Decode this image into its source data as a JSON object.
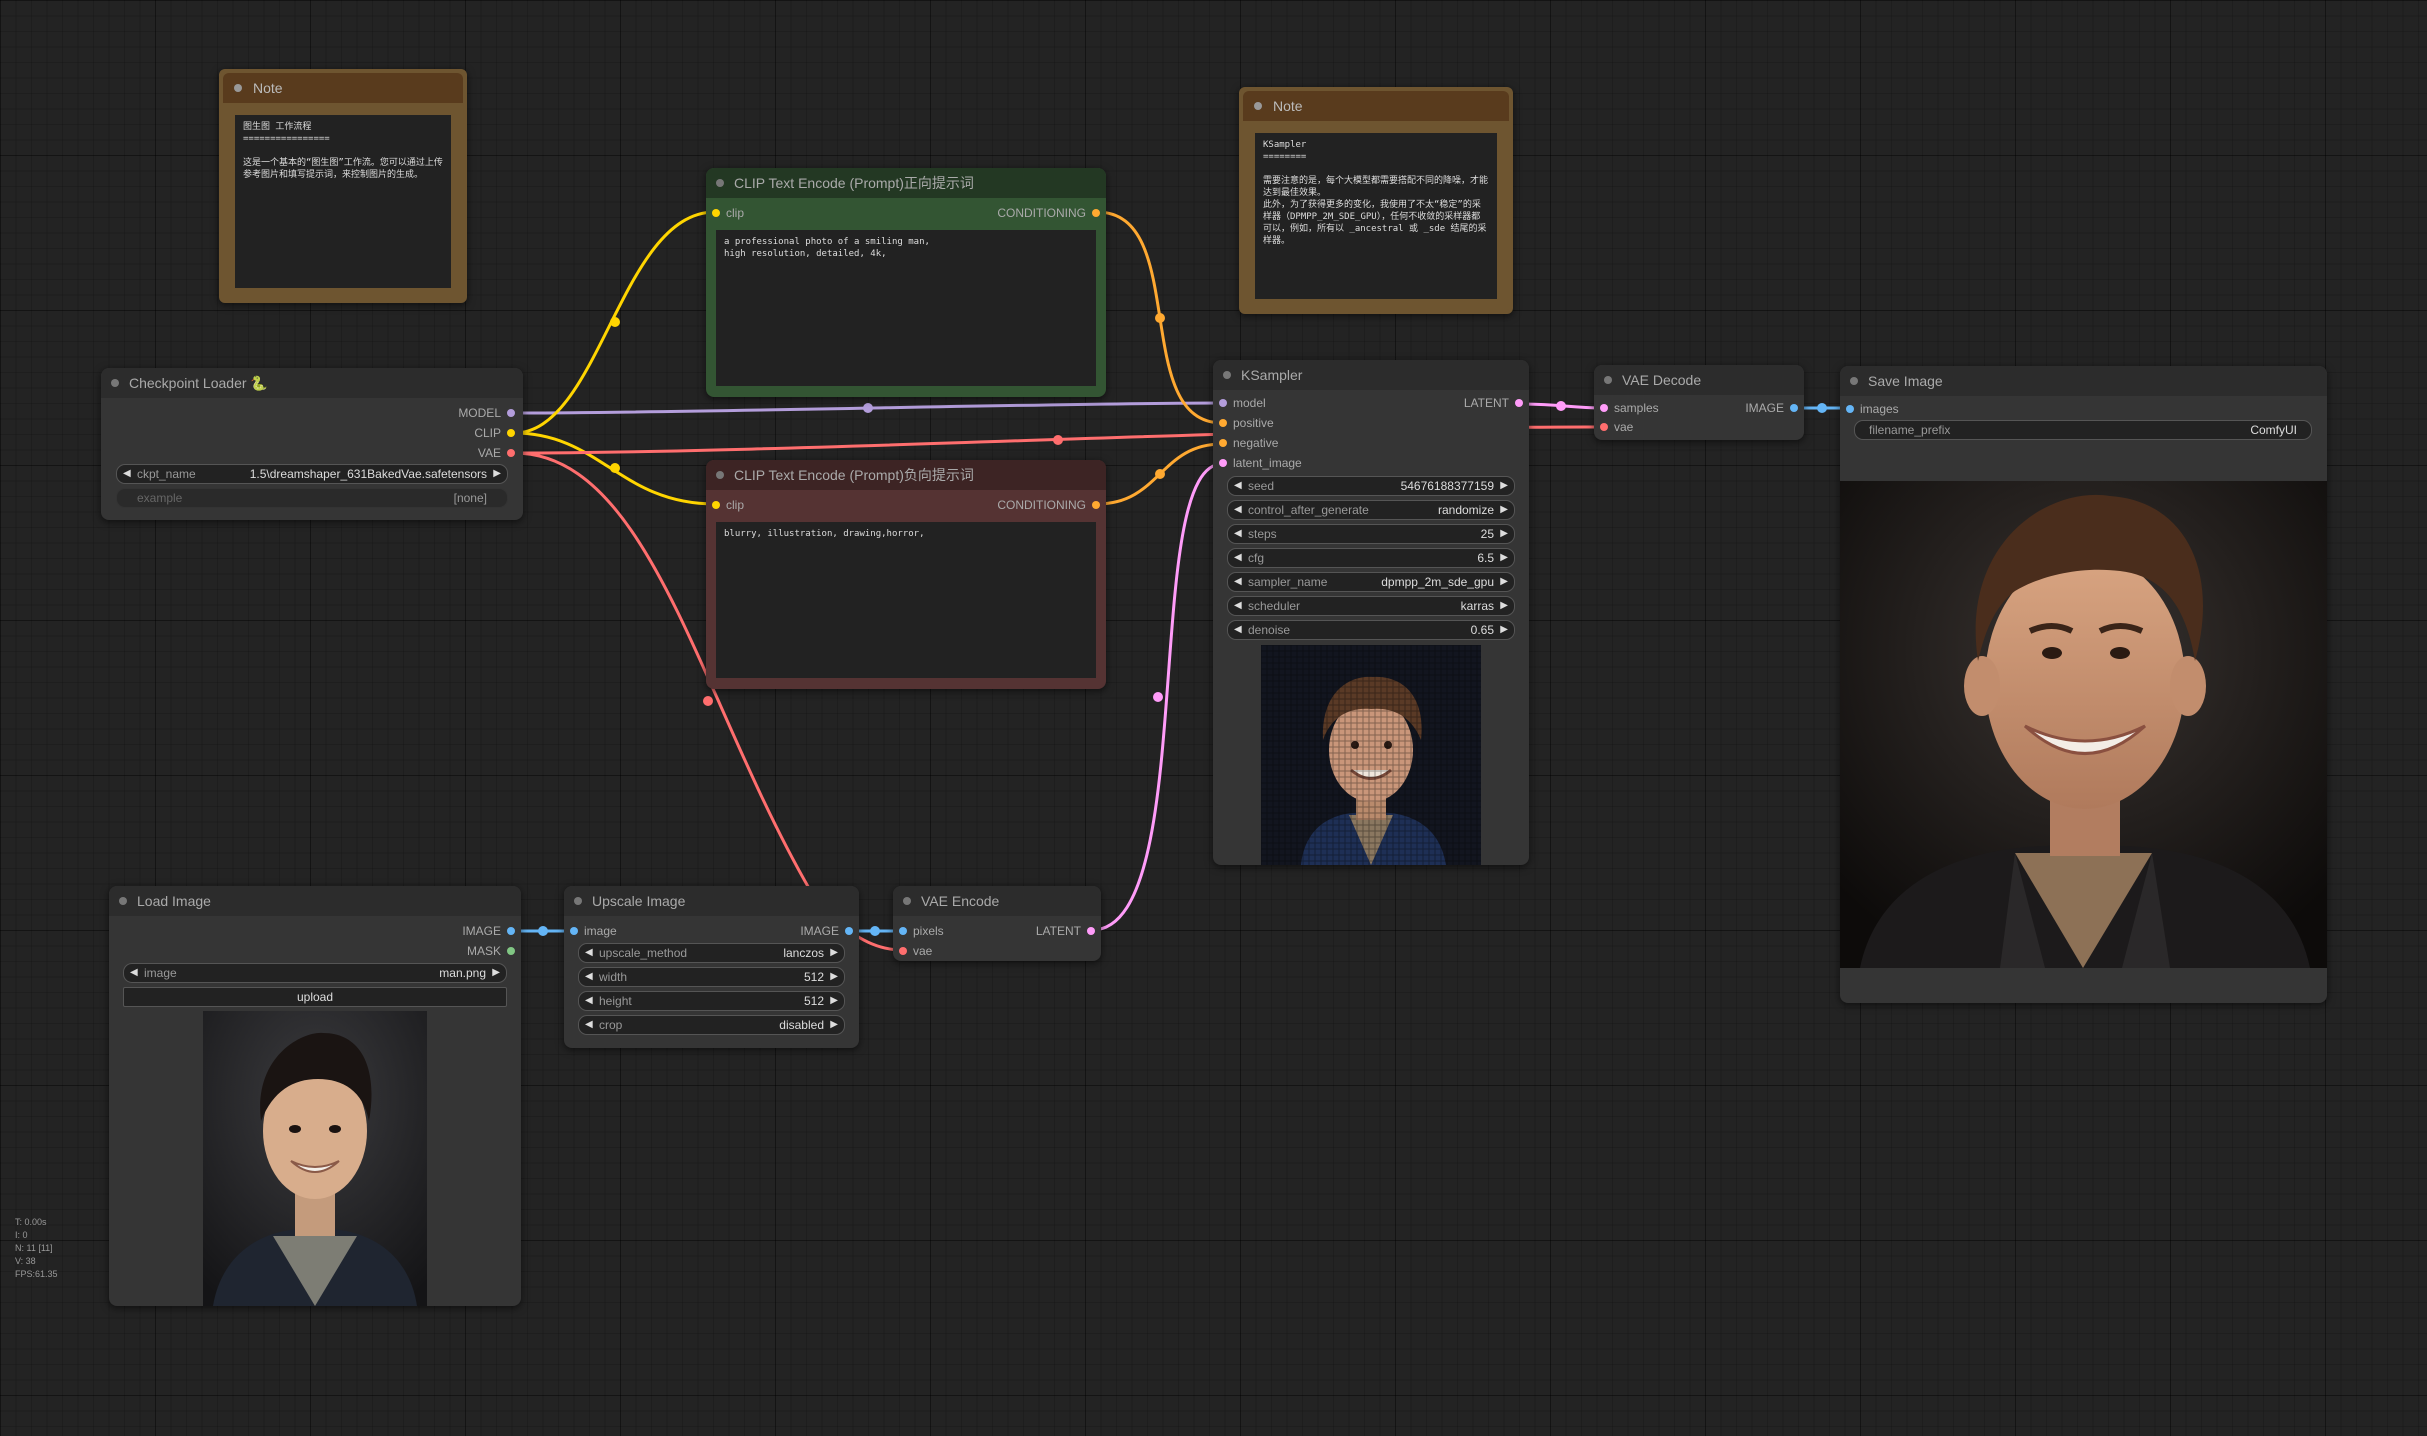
{
  "notes": [
    {
      "title": "Note",
      "text": "图生图 工作流程\n================\n\n这是一个基本的“图生图”工作流。您可以通过上传参考图片和填写提示词，来控制图片的生成。"
    },
    {
      "title": "Note",
      "text": "KSampler\n========\n\n需要注意的是，每个大模型都需要搭配不同的降噪，才能达到最佳效果。\n此外，为了获得更多的变化，我使用了不太“稳定”的采样器（DPMPP_2M_SDE_GPU），任何不收敛的采样器都可以，例如，所有以 _ancestral 或 _sde 结尾的采样器。"
    }
  ],
  "checkpoint": {
    "title": "Checkpoint Loader 🐍",
    "outputs": [
      "MODEL",
      "CLIP",
      "VAE"
    ],
    "ckpt_name_label": "ckpt_name",
    "ckpt_name": "1.5\\dreamshaper_631BakedVae.safetensors",
    "example_label": "example",
    "example_value": "[none]"
  },
  "clip_pos": {
    "title": "CLIP Text Encode (Prompt)正向提示词",
    "input": "clip",
    "output": "CONDITIONING",
    "text": "a professional photo of a smiling man,\nhigh resolution, detailed, 4k,"
  },
  "clip_neg": {
    "title": "CLIP Text Encode (Prompt)负向提示词",
    "input": "clip",
    "output": "CONDITIONING",
    "text": "blurry, illustration, drawing,horror,"
  },
  "ksampler": {
    "title": "KSampler",
    "inputs": [
      "model",
      "positive",
      "negative",
      "latent_image"
    ],
    "output": "LATENT",
    "widgets": [
      {
        "name": "seed",
        "value": "54676188377159"
      },
      {
        "name": "control_after_generate",
        "value": "randomize"
      },
      {
        "name": "steps",
        "value": "25"
      },
      {
        "name": "cfg",
        "value": "6.5"
      },
      {
        "name": "sampler_name",
        "value": "dpmpp_2m_sde_gpu"
      },
      {
        "name": "scheduler",
        "value": "karras"
      },
      {
        "name": "denoise",
        "value": "0.65"
      }
    ]
  },
  "vae_decode": {
    "title": "VAE Decode",
    "inputs": [
      "samples",
      "vae"
    ],
    "output": "IMAGE"
  },
  "save_image": {
    "title": "Save Image",
    "input": "images",
    "prefix_label": "filename_prefix",
    "prefix_value": "ComfyUI"
  },
  "load_image": {
    "title": "Load Image",
    "outputs": [
      "IMAGE",
      "MASK"
    ],
    "image_label": "image",
    "image_value": "man.png",
    "upload_label": "upload"
  },
  "upscale": {
    "title": "Upscale Image",
    "input": "image",
    "output": "IMAGE",
    "widgets": [
      {
        "name": "upscale_method",
        "value": "lanczos"
      },
      {
        "name": "width",
        "value": "512"
      },
      {
        "name": "height",
        "value": "512"
      },
      {
        "name": "crop",
        "value": "disabled"
      }
    ]
  },
  "vae_encode": {
    "title": "VAE Encode",
    "inputs": [
      "pixels",
      "vae"
    ],
    "output": "LATENT"
  },
  "stats": [
    "T: 0.00s",
    "I: 0",
    "N: 11 [11]",
    "V: 38",
    "FPS:61.35"
  ],
  "colors": {
    "model": "#b39ddb",
    "clip": "#ffd500",
    "vae": "#ff6e6e",
    "conditioning": "#ffa931",
    "latent": "#ff9cf9",
    "image": "#64b5f6",
    "mask": "#81c784"
  }
}
